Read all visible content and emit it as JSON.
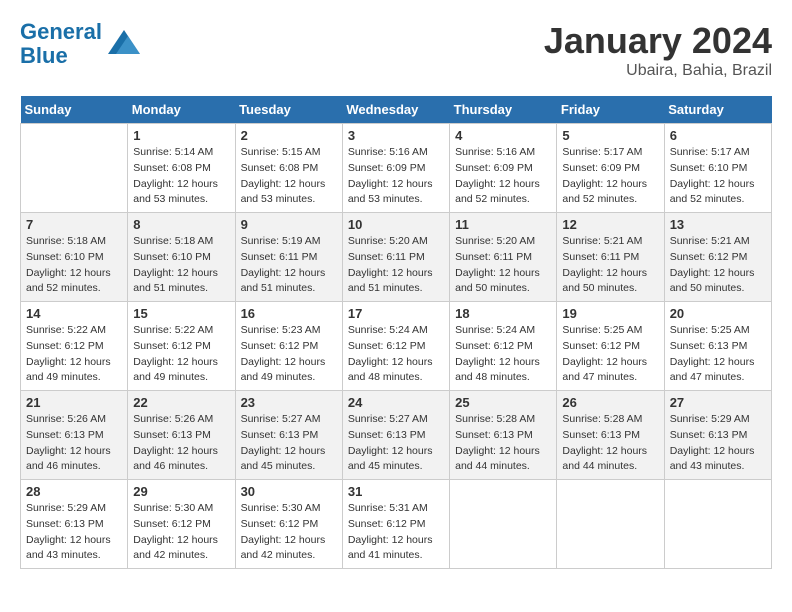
{
  "header": {
    "logo_line1": "General",
    "logo_line2": "Blue",
    "month": "January 2024",
    "location": "Ubaira, Bahia, Brazil"
  },
  "weekdays": [
    "Sunday",
    "Monday",
    "Tuesday",
    "Wednesday",
    "Thursday",
    "Friday",
    "Saturday"
  ],
  "weeks": [
    [
      {
        "day": "",
        "info": ""
      },
      {
        "day": "1",
        "info": "Sunrise: 5:14 AM\nSunset: 6:08 PM\nDaylight: 12 hours\nand 53 minutes."
      },
      {
        "day": "2",
        "info": "Sunrise: 5:15 AM\nSunset: 6:08 PM\nDaylight: 12 hours\nand 53 minutes."
      },
      {
        "day": "3",
        "info": "Sunrise: 5:16 AM\nSunset: 6:09 PM\nDaylight: 12 hours\nand 53 minutes."
      },
      {
        "day": "4",
        "info": "Sunrise: 5:16 AM\nSunset: 6:09 PM\nDaylight: 12 hours\nand 52 minutes."
      },
      {
        "day": "5",
        "info": "Sunrise: 5:17 AM\nSunset: 6:09 PM\nDaylight: 12 hours\nand 52 minutes."
      },
      {
        "day": "6",
        "info": "Sunrise: 5:17 AM\nSunset: 6:10 PM\nDaylight: 12 hours\nand 52 minutes."
      }
    ],
    [
      {
        "day": "7",
        "info": "Sunrise: 5:18 AM\nSunset: 6:10 PM\nDaylight: 12 hours\nand 52 minutes."
      },
      {
        "day": "8",
        "info": "Sunrise: 5:18 AM\nSunset: 6:10 PM\nDaylight: 12 hours\nand 51 minutes."
      },
      {
        "day": "9",
        "info": "Sunrise: 5:19 AM\nSunset: 6:11 PM\nDaylight: 12 hours\nand 51 minutes."
      },
      {
        "day": "10",
        "info": "Sunrise: 5:20 AM\nSunset: 6:11 PM\nDaylight: 12 hours\nand 51 minutes."
      },
      {
        "day": "11",
        "info": "Sunrise: 5:20 AM\nSunset: 6:11 PM\nDaylight: 12 hours\nand 50 minutes."
      },
      {
        "day": "12",
        "info": "Sunrise: 5:21 AM\nSunset: 6:11 PM\nDaylight: 12 hours\nand 50 minutes."
      },
      {
        "day": "13",
        "info": "Sunrise: 5:21 AM\nSunset: 6:12 PM\nDaylight: 12 hours\nand 50 minutes."
      }
    ],
    [
      {
        "day": "14",
        "info": "Sunrise: 5:22 AM\nSunset: 6:12 PM\nDaylight: 12 hours\nand 49 minutes."
      },
      {
        "day": "15",
        "info": "Sunrise: 5:22 AM\nSunset: 6:12 PM\nDaylight: 12 hours\nand 49 minutes."
      },
      {
        "day": "16",
        "info": "Sunrise: 5:23 AM\nSunset: 6:12 PM\nDaylight: 12 hours\nand 49 minutes."
      },
      {
        "day": "17",
        "info": "Sunrise: 5:24 AM\nSunset: 6:12 PM\nDaylight: 12 hours\nand 48 minutes."
      },
      {
        "day": "18",
        "info": "Sunrise: 5:24 AM\nSunset: 6:12 PM\nDaylight: 12 hours\nand 48 minutes."
      },
      {
        "day": "19",
        "info": "Sunrise: 5:25 AM\nSunset: 6:12 PM\nDaylight: 12 hours\nand 47 minutes."
      },
      {
        "day": "20",
        "info": "Sunrise: 5:25 AM\nSunset: 6:13 PM\nDaylight: 12 hours\nand 47 minutes."
      }
    ],
    [
      {
        "day": "21",
        "info": "Sunrise: 5:26 AM\nSunset: 6:13 PM\nDaylight: 12 hours\nand 46 minutes."
      },
      {
        "day": "22",
        "info": "Sunrise: 5:26 AM\nSunset: 6:13 PM\nDaylight: 12 hours\nand 46 minutes."
      },
      {
        "day": "23",
        "info": "Sunrise: 5:27 AM\nSunset: 6:13 PM\nDaylight: 12 hours\nand 45 minutes."
      },
      {
        "day": "24",
        "info": "Sunrise: 5:27 AM\nSunset: 6:13 PM\nDaylight: 12 hours\nand 45 minutes."
      },
      {
        "day": "25",
        "info": "Sunrise: 5:28 AM\nSunset: 6:13 PM\nDaylight: 12 hours\nand 44 minutes."
      },
      {
        "day": "26",
        "info": "Sunrise: 5:28 AM\nSunset: 6:13 PM\nDaylight: 12 hours\nand 44 minutes."
      },
      {
        "day": "27",
        "info": "Sunrise: 5:29 AM\nSunset: 6:13 PM\nDaylight: 12 hours\nand 43 minutes."
      }
    ],
    [
      {
        "day": "28",
        "info": "Sunrise: 5:29 AM\nSunset: 6:13 PM\nDaylight: 12 hours\nand 43 minutes."
      },
      {
        "day": "29",
        "info": "Sunrise: 5:30 AM\nSunset: 6:12 PM\nDaylight: 12 hours\nand 42 minutes."
      },
      {
        "day": "30",
        "info": "Sunrise: 5:30 AM\nSunset: 6:12 PM\nDaylight: 12 hours\nand 42 minutes."
      },
      {
        "day": "31",
        "info": "Sunrise: 5:31 AM\nSunset: 6:12 PM\nDaylight: 12 hours\nand 41 minutes."
      },
      {
        "day": "",
        "info": ""
      },
      {
        "day": "",
        "info": ""
      },
      {
        "day": "",
        "info": ""
      }
    ]
  ]
}
